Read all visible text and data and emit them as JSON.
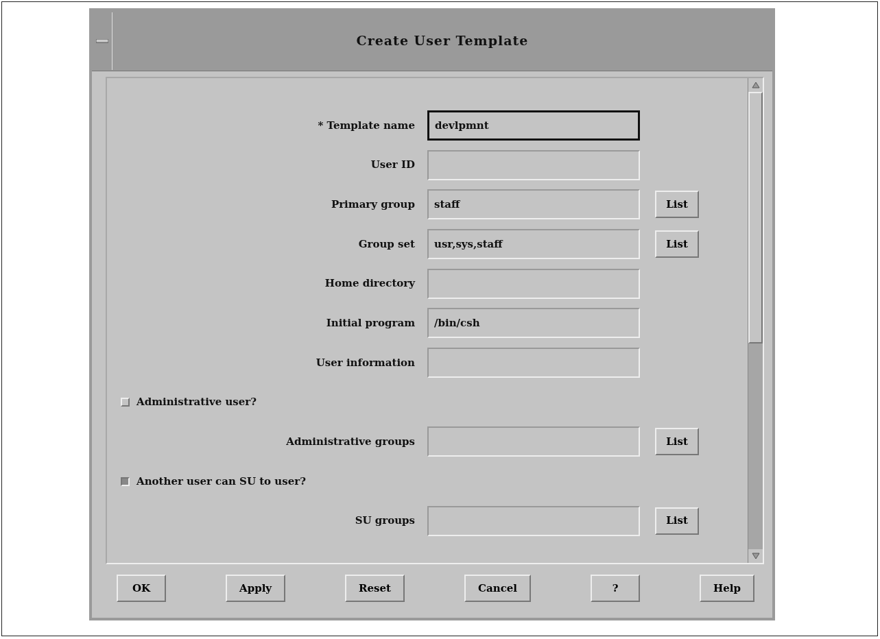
{
  "window": {
    "title": "Create User Template"
  },
  "rows": [
    {
      "kind": "field",
      "label": "* Template name",
      "value": "devlpmnt",
      "focused": true,
      "list_button": null
    },
    {
      "kind": "field",
      "label": "User ID",
      "focused": false,
      "list_button": null
    },
    {
      "kind": "field",
      "label": "Primary group",
      "value": "staff",
      "focused": false,
      "list_button": "List"
    },
    {
      "kind": "field",
      "label": "Group set",
      "value": "usr,sys,staff",
      "focused": false,
      "list_button": "List"
    },
    {
      "kind": "field",
      "label": "Home directory",
      "focused": false,
      "list_button": null
    },
    {
      "kind": "field",
      "label": "Initial program",
      "value": "/bin/csh",
      "focused": false,
      "list_button": null
    },
    {
      "kind": "field",
      "label": "User information",
      "focused": false,
      "list_button": null
    },
    {
      "kind": "checkbox",
      "label": "Administrative user?",
      "checked": false
    },
    {
      "kind": "field",
      "label": "Administrative groups",
      "focused": false,
      "list_button": "List"
    },
    {
      "kind": "checkbox",
      "label": "Another user can SU to user?",
      "checked": true
    },
    {
      "kind": "field",
      "label": "SU groups",
      "focused": false,
      "list_button": "List"
    }
  ],
  "buttons": [
    "OK",
    "Apply",
    "Reset",
    "Cancel",
    "?",
    "Help"
  ]
}
